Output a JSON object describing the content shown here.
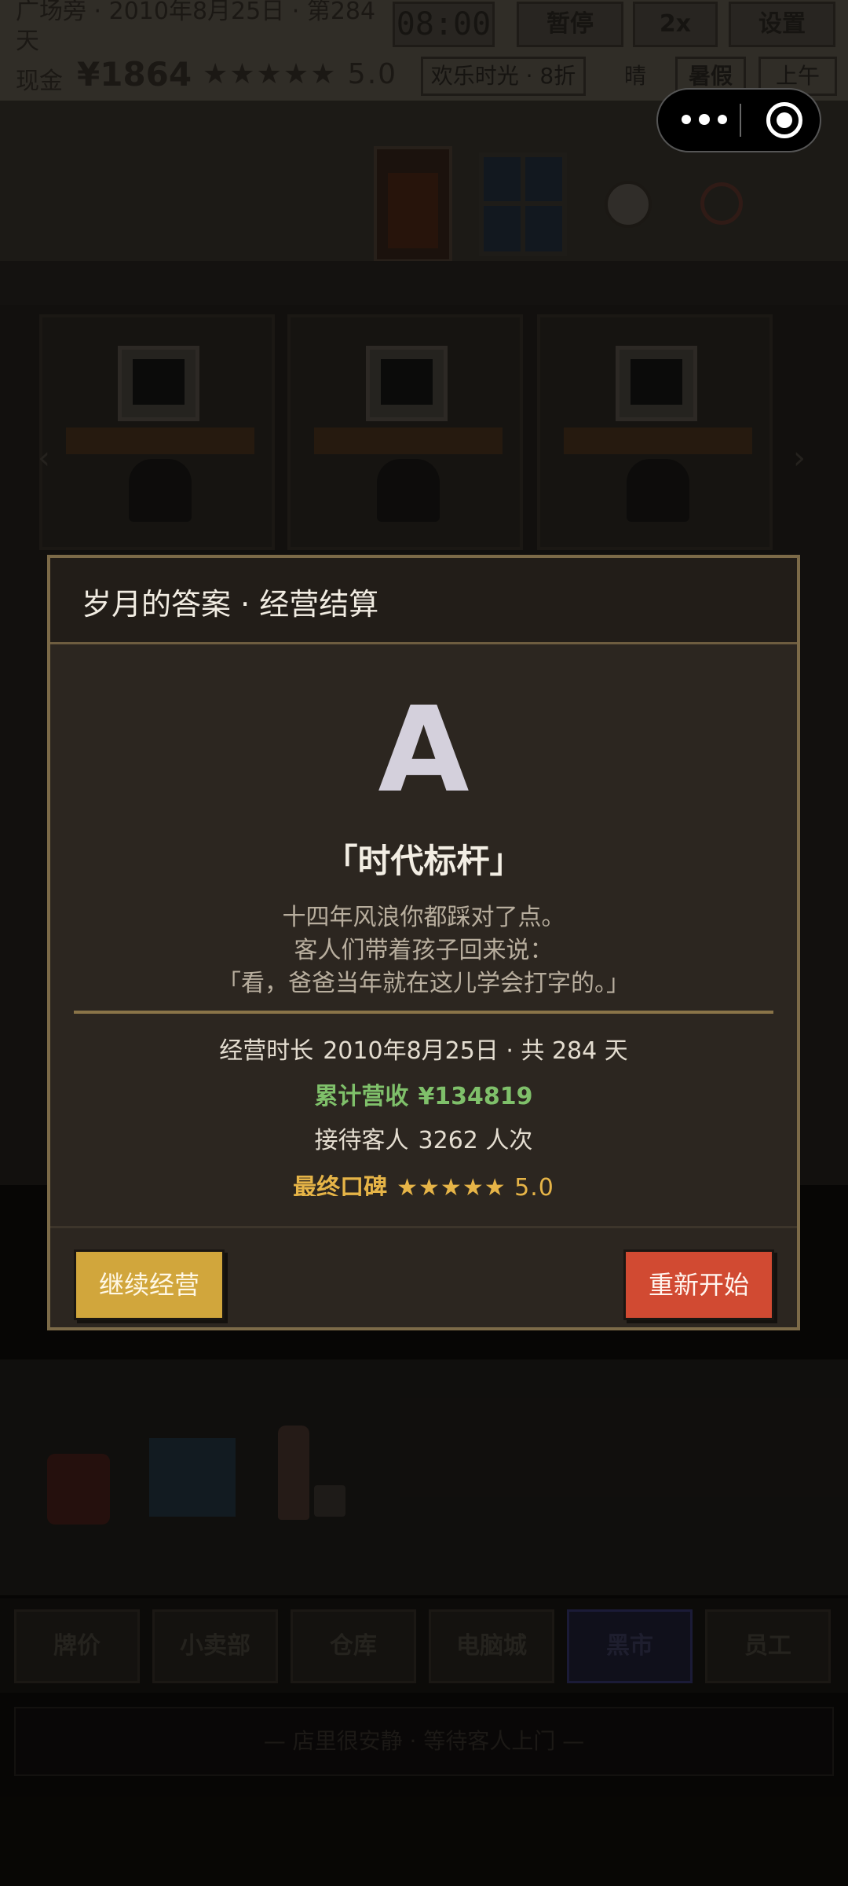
{
  "hud": {
    "location": "广场旁 · 2010年8月25日 · 第284天",
    "cash_label": "现金",
    "cash": "¥1864",
    "stars": "★★★★★ 5.0",
    "clock": "08:00",
    "pause": "暂停",
    "speed": "2x",
    "settings": "设置",
    "promo": "欢乐时光 · 8折",
    "weather": "晴",
    "holiday": "暑假",
    "time_of_day": "上午"
  },
  "tabs": [
    "牌价",
    "小卖部",
    "仓库",
    "电脑城",
    "黑市",
    "员工"
  ],
  "status": "— 店里很安静 · 等待客人上门 —",
  "modal": {
    "title": "岁月的答案 · 经营结算",
    "grade": "A",
    "grade_title": "「时代标杆」",
    "description": [
      "十四年风浪你都踩对了点。",
      "客人们带着孩子回来说：",
      "「看，爸爸当年就在这儿学会打字的。」"
    ],
    "stats": {
      "duration_label": "经营时长",
      "duration_value": "2010年8月25日 · 共 284 天",
      "revenue_label": "累计营收",
      "revenue_value": "¥134819",
      "customers_label": "接待客人",
      "customers_value": "3262 人次",
      "reputation_label": "最终口碑",
      "reputation_value": "★★★★★ 5.0"
    },
    "continue_label": "继续经营",
    "restart_label": "重新开始"
  },
  "colors": {
    "modal_bg": "#2c2620",
    "modal_border": "#7c6a48",
    "revenue": "#7fc06a",
    "reputation": "#e6b447",
    "continue_btn": "#d1a63c",
    "restart_btn": "#d14a32"
  }
}
